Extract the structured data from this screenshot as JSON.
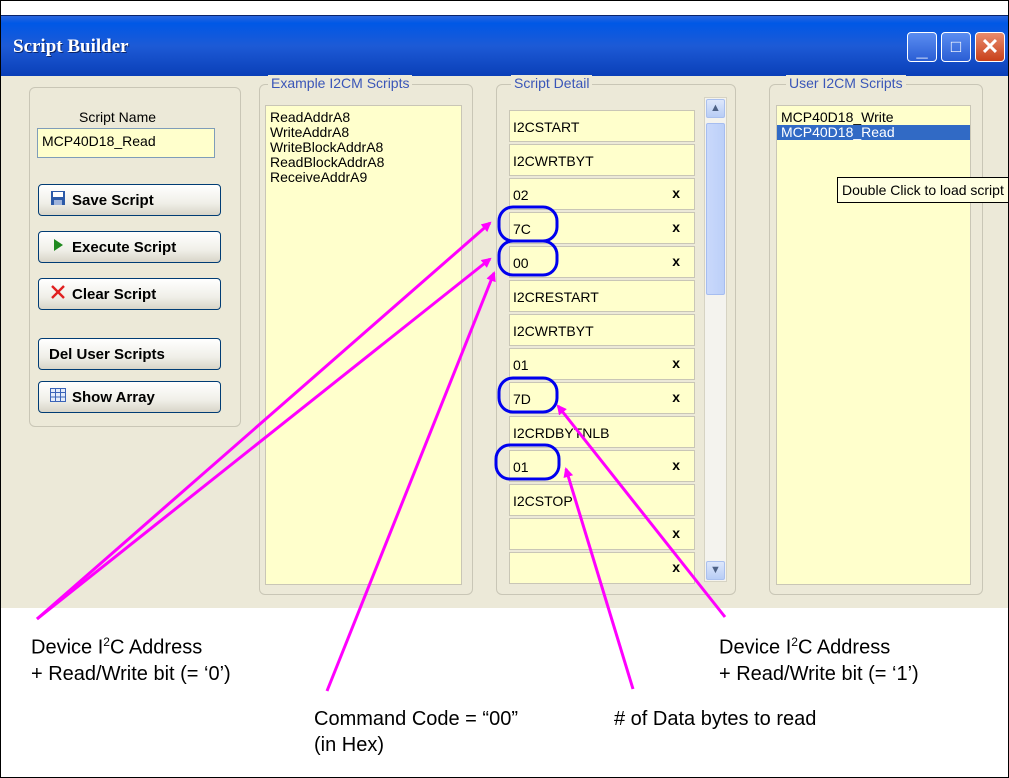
{
  "window": {
    "title": "Script Builder",
    "controls": {
      "minimize": "_",
      "maximize": "□",
      "close": "✕"
    }
  },
  "left_panel": {
    "script_name_label": "Script Name",
    "script_name_value": "MCP40D18_Read",
    "buttons": {
      "save": "Save Script",
      "execute": "Execute Script",
      "clear": "Clear Script",
      "del_user": "Del User Scripts",
      "show_array": "Show Array"
    },
    "icons": {
      "save": "floppy-disk-icon",
      "execute": "play-triangle-icon",
      "clear": "red-x-icon",
      "show_array": "grid-table-icon"
    }
  },
  "example_scripts": {
    "header": "Example I2CM Scripts",
    "items": [
      "ReadAddrA8",
      "WriteAddrA8",
      "WriteBlockAddrA8",
      "ReadBlockAddrA8",
      "ReceiveAddrA9"
    ]
  },
  "script_detail": {
    "header": "Script Detail",
    "rows": [
      {
        "text": "I2CSTART",
        "x": ""
      },
      {
        "text": "I2CWRTBYT",
        "x": ""
      },
      {
        "text": "02",
        "x": "x"
      },
      {
        "text": "7C",
        "x": "x"
      },
      {
        "text": "00",
        "x": "x"
      },
      {
        "text": "I2CRESTART",
        "x": ""
      },
      {
        "text": "I2CWRTBYT",
        "x": ""
      },
      {
        "text": "01",
        "x": "x"
      },
      {
        "text": "7D",
        "x": "x"
      },
      {
        "text": "I2CRDBYTNLB",
        "x": ""
      },
      {
        "text": "01",
        "x": "x"
      },
      {
        "text": "I2CSTOP",
        "x": ""
      },
      {
        "text": "",
        "x": "x"
      },
      {
        "text": "",
        "x": "x"
      }
    ]
  },
  "user_scripts": {
    "header": "User I2CM Scripts",
    "items": [
      {
        "text": "MCP40D18_Write",
        "selected": false
      },
      {
        "text": "MCP40D18_Read",
        "selected": true
      }
    ]
  },
  "tooltip": "Double Click to load script",
  "annotations": {
    "dev_addr_write": {
      "line1": "Device I",
      "sup": "2",
      "line1_tail": "C Address",
      "line2": "+ Read/Write bit (= ‘0’)"
    },
    "command_code": {
      "line1": "Command Code = “00”",
      "line2": "(in Hex)"
    },
    "data_bytes": {
      "line1": "# of Data bytes to read"
    },
    "dev_addr_read": {
      "line1": "Device I",
      "sup": "2",
      "line1_tail": "C Address",
      "line2": "+ Read/Write bit (= ‘1’)"
    },
    "colors": {
      "arrow": "#ff00ff",
      "highlight": "#0000ee"
    }
  }
}
